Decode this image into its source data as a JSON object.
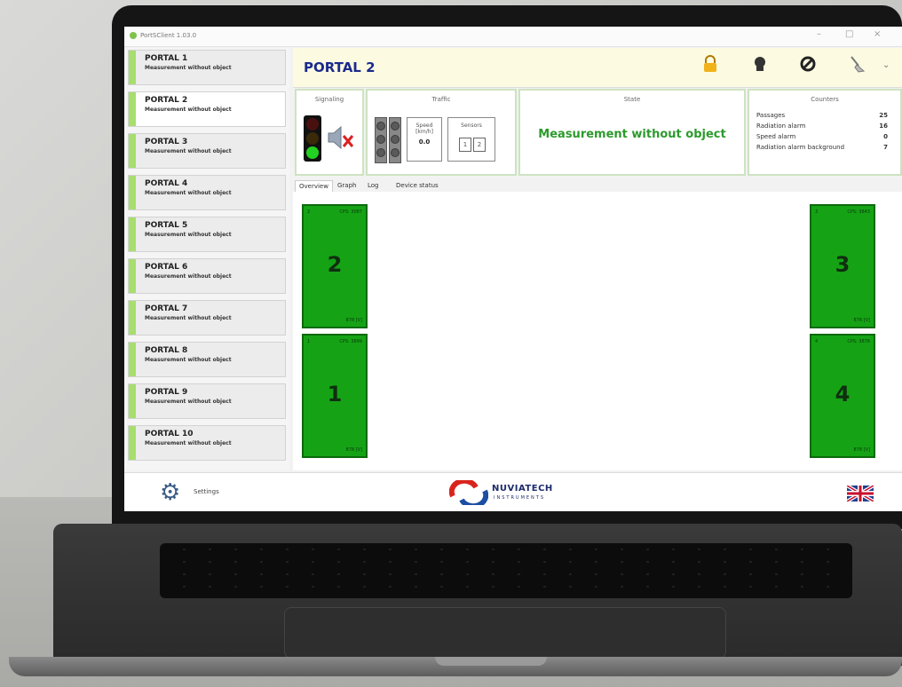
{
  "app": {
    "title": "PortSClient 1.03.0"
  },
  "sidebar": {
    "portals": [
      {
        "name": "PORTAL 1",
        "status": "Measurement without object"
      },
      {
        "name": "PORTAL 2",
        "status": "Measurement without object"
      },
      {
        "name": "PORTAL 3",
        "status": "Measurement without object"
      },
      {
        "name": "PORTAL 4",
        "status": "Measurement without object"
      },
      {
        "name": "PORTAL 5",
        "status": "Measurement without object"
      },
      {
        "name": "PORTAL 6",
        "status": "Measurement without object"
      },
      {
        "name": "PORTAL 7",
        "status": "Measurement without object"
      },
      {
        "name": "PORTAL 8",
        "status": "Measurement without object"
      },
      {
        "name": "PORTAL 9",
        "status": "Measurement without object"
      },
      {
        "name": "PORTAL 10",
        "status": "Measurement without object"
      }
    ],
    "selected_index": 1
  },
  "header": {
    "title": "PORTAL 2",
    "icons": [
      "lock-icon",
      "camera-icon",
      "cancel-icon",
      "broom-icon"
    ]
  },
  "signaling": {
    "label": "Signaling",
    "light_state": "green",
    "sound": "muted"
  },
  "traffic": {
    "label": "Traffic",
    "speed_label": "Speed [km/h]",
    "speed_value": "0.0",
    "sensors_label": "Sensors",
    "sensors": [
      "1",
      "2"
    ]
  },
  "state": {
    "label": "State",
    "value": "Measurement without object"
  },
  "counters": {
    "label": "Counters",
    "rows": [
      {
        "label": "Passages",
        "value": "25"
      },
      {
        "label": "Radiation alarm",
        "value": "16"
      },
      {
        "label": "Speed alarm",
        "value": "0"
      },
      {
        "label": "Radiation alarm background",
        "value": "7"
      }
    ]
  },
  "tabs": [
    "Overview",
    "Graph",
    "Log",
    "Device status"
  ],
  "active_tab": 0,
  "detectors": [
    {
      "number": "2",
      "index": "2",
      "cps": "CPS: 3087",
      "voltage": "878 [V]"
    },
    {
      "number": "1",
      "index": "1",
      "cps": "CPS: 3899",
      "voltage": "878 [V]"
    },
    {
      "number": "3",
      "index": "3",
      "cps": "CPS: 3843",
      "voltage": "878 [V]"
    },
    {
      "number": "4",
      "index": "4",
      "cps": "CPS: 3878",
      "voltage": "878 [V]"
    }
  ],
  "colors": {
    "detector_green": "#15a315",
    "state_green": "#2c9a2c",
    "title_blue": "#1b2a8c"
  },
  "footer": {
    "settings_label": "Settings",
    "brand": "NUVIATECH",
    "brand_sub": "INSTRUMENTS",
    "language_icon": "uk-flag-icon"
  }
}
